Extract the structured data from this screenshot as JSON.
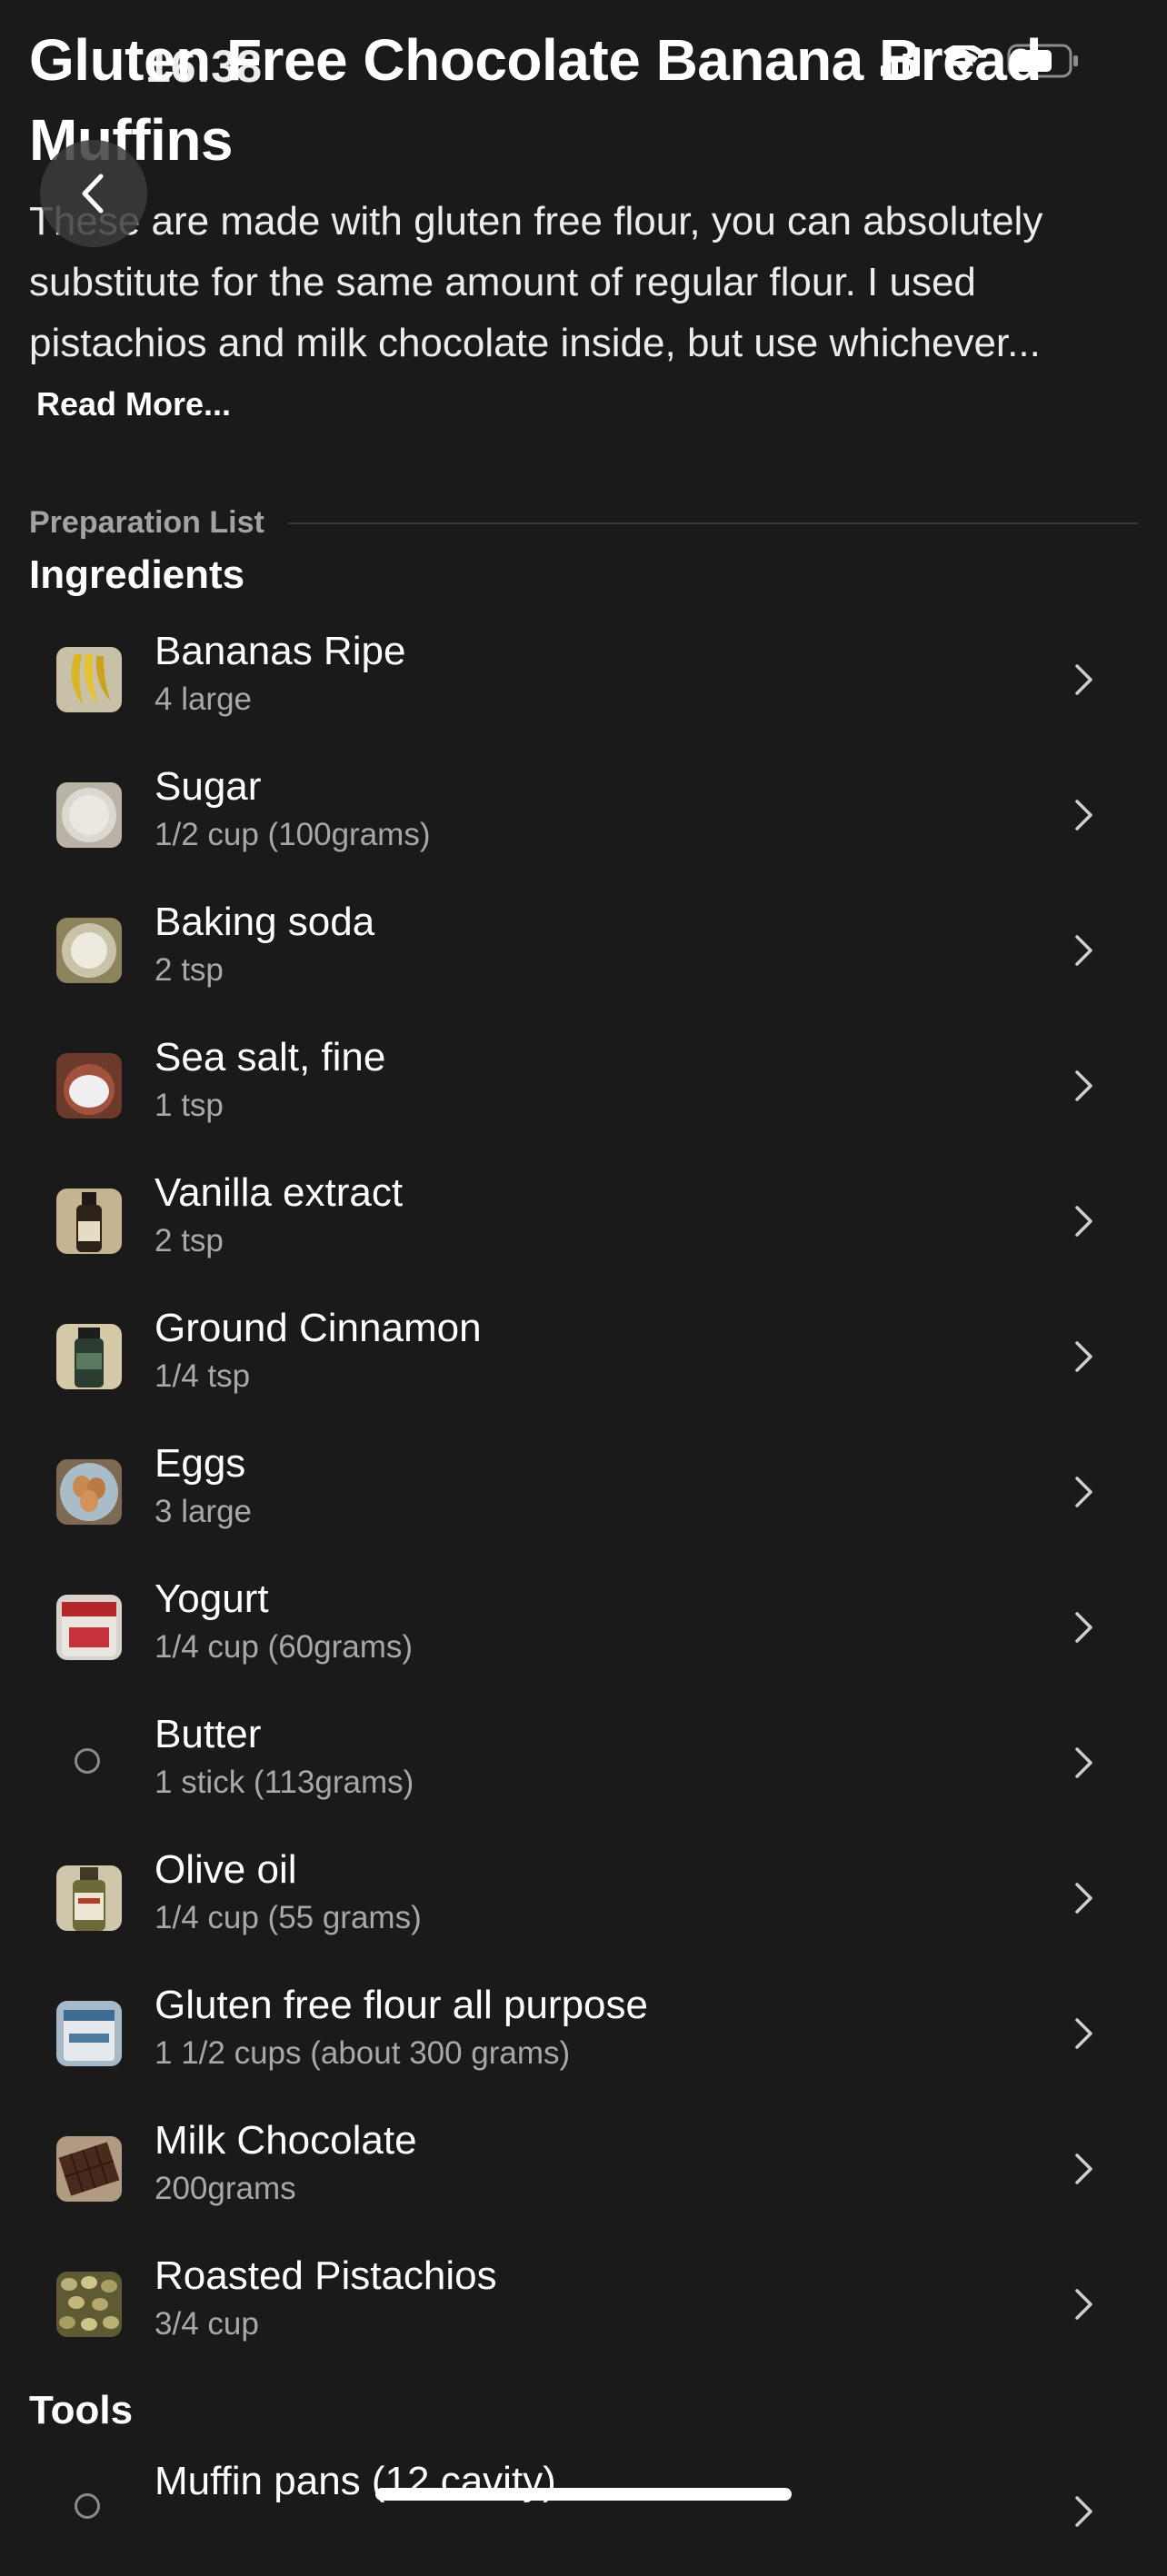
{
  "status_bar": {
    "time": "16:38"
  },
  "recipe": {
    "title": "Gluten Free Chocolate Banana Bread Muffins",
    "description": "These are made with gluten free flour, you can absolutely substitute for the same amount of regular flour. I used pistachios and milk chocolate inside, but use whichever...",
    "read_more_label": "Read More..."
  },
  "preparation": {
    "label": "Preparation List"
  },
  "ingredients": {
    "title": "Ingredients",
    "items": [
      {
        "name": "Bananas Ripe",
        "qty": "4 large",
        "icon": "banana-thumbnail"
      },
      {
        "name": "Sugar",
        "qty": "1/2 cup (100grams)",
        "icon": "sugar-thumbnail"
      },
      {
        "name": "Baking soda",
        "qty": "2 tsp",
        "icon": "baking-soda-thumbnail"
      },
      {
        "name": "Sea salt, fine",
        "qty": "1 tsp",
        "icon": "sea-salt-thumbnail"
      },
      {
        "name": "Vanilla extract",
        "qty": "2 tsp",
        "icon": "vanilla-extract-thumbnail"
      },
      {
        "name": "Ground Cinnamon",
        "qty": "1/4 tsp",
        "icon": "cinnamon-thumbnail"
      },
      {
        "name": "Eggs",
        "qty": "3 large",
        "icon": "eggs-thumbnail"
      },
      {
        "name": "Yogurt",
        "qty": "1/4 cup (60grams)",
        "icon": "yogurt-thumbnail"
      },
      {
        "name": "Butter",
        "qty": "1 stick (113grams)",
        "icon": "empty-circle-icon"
      },
      {
        "name": "Olive oil",
        "qty": "1/4 cup (55 grams)",
        "icon": "olive-oil-thumbnail"
      },
      {
        "name": "Gluten free flour all purpose",
        "qty": "1 1/2 cups (about 300 grams)",
        "icon": "flour-thumbnail"
      },
      {
        "name": "Milk Chocolate",
        "qty": "200grams",
        "icon": "chocolate-thumbnail"
      },
      {
        "name": "Roasted Pistachios",
        "qty": "3/4 cup",
        "icon": "pistachios-thumbnail"
      }
    ]
  },
  "tools": {
    "title": "Tools",
    "items": [
      {
        "name": "Muffin pans (12 cavity)",
        "qty": "",
        "icon": "empty-circle-icon"
      }
    ]
  }
}
